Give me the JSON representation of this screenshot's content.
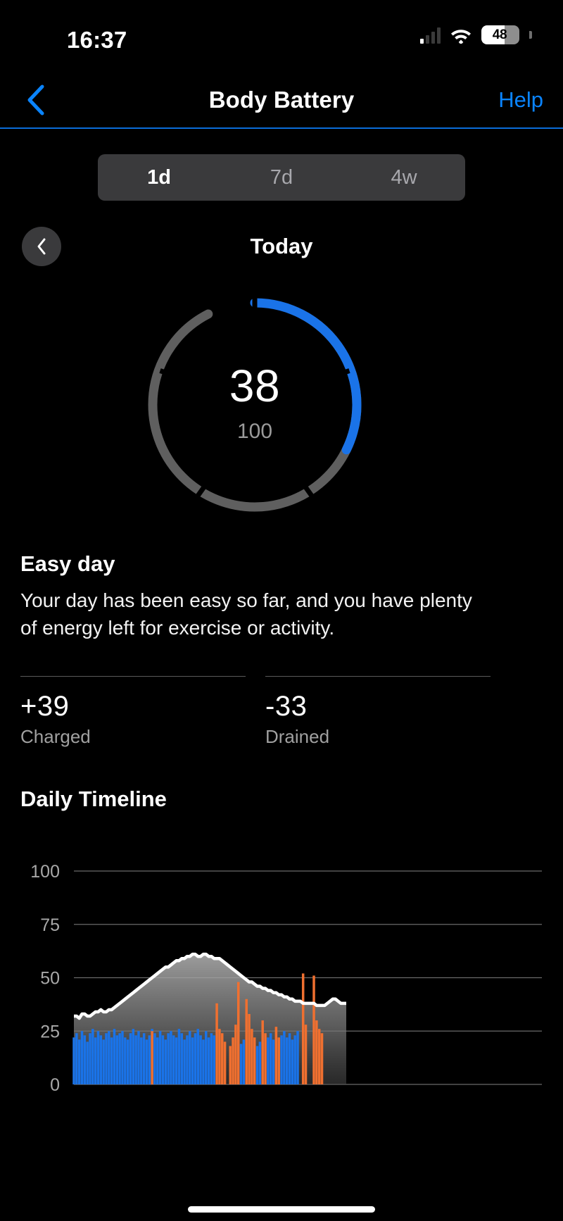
{
  "status_bar": {
    "time": "16:37",
    "signal_icon": "cellular-signal-icon",
    "wifi_icon": "wifi-icon",
    "battery_level": "48",
    "battery_icon": "battery-icon"
  },
  "nav": {
    "back_icon": "chevron-left-icon",
    "title": "Body Battery",
    "help_label": "Help"
  },
  "range_selector": {
    "options": [
      {
        "label": "1d",
        "selected": true
      },
      {
        "label": "7d",
        "selected": false
      },
      {
        "label": "4w",
        "selected": false
      }
    ]
  },
  "day_nav": {
    "prev_icon": "chevron-left-icon",
    "label": "Today"
  },
  "gauge": {
    "value": "38",
    "max": "100",
    "fill_color": "#1a73e8",
    "track_color": "#5f5f5f"
  },
  "summary": {
    "title": "Easy day",
    "description": "Your day has been easy so far, and you have plenty of energy left for exercise or activity."
  },
  "stats": [
    {
      "value": "+39",
      "label": "Charged"
    },
    {
      "value": "-33",
      "label": "Drained"
    }
  ],
  "timeline": {
    "title": "Daily Timeline"
  },
  "chart_data": {
    "type": "area",
    "title": "Daily Timeline",
    "xlabel": "",
    "ylabel": "",
    "ylim": [
      0,
      100
    ],
    "yticks": [
      0,
      25,
      50,
      75,
      100
    ],
    "ytick_labels": [
      "0",
      "25",
      "50",
      "75",
      "100"
    ],
    "grid": true,
    "legend": null,
    "line_color": "#ffffff",
    "fill_color": "#8a8a8a",
    "series": [
      {
        "name": "Body Battery",
        "type": "area",
        "values": [
          32,
          32,
          31,
          33,
          33,
          32,
          32,
          33,
          34,
          34,
          35,
          34,
          34,
          35,
          35,
          36,
          37,
          38,
          39,
          40,
          41,
          42,
          43,
          44,
          45,
          46,
          47,
          48,
          49,
          50,
          51,
          52,
          53,
          54,
          55,
          55,
          56,
          57,
          58,
          58,
          59,
          59,
          60,
          60,
          61,
          61,
          60,
          60,
          61,
          61,
          60,
          60,
          59,
          59,
          59,
          58,
          57,
          56,
          55,
          54,
          53,
          52,
          51,
          50,
          49,
          48,
          48,
          47,
          46,
          46,
          45,
          45,
          44,
          44,
          43,
          43,
          42,
          42,
          41,
          41,
          40,
          40,
          39,
          39,
          39,
          38,
          38,
          38,
          38,
          38,
          37,
          37,
          37,
          37,
          38,
          39,
          40,
          40,
          39,
          38,
          38,
          38
        ]
      },
      {
        "name": "Charge (blue bars)",
        "type": "bar",
        "color": "#1a73e8",
        "values": [
          22,
          24,
          21,
          25,
          23,
          20,
          24,
          26,
          22,
          25,
          23,
          21,
          24,
          25,
          22,
          26,
          23,
          24,
          25,
          22,
          21,
          24,
          26,
          23,
          25,
          22,
          24,
          21,
          23,
          26,
          24,
          22,
          25,
          23,
          21,
          24,
          25,
          23,
          22,
          26,
          24,
          21,
          23,
          25,
          22,
          24,
          26,
          23,
          21,
          25,
          22,
          24,
          23,
          0,
          0,
          0,
          0,
          0,
          0,
          0,
          0,
          0,
          19,
          21,
          0,
          0,
          0,
          0,
          18,
          20,
          0,
          0,
          22,
          24,
          21,
          0,
          0,
          23,
          25,
          22,
          24,
          21,
          23,
          25,
          0,
          0,
          0,
          0,
          0,
          0,
          0,
          0,
          0,
          0,
          0,
          0,
          0,
          0,
          0,
          0,
          0,
          0
        ]
      },
      {
        "name": "Drain (orange bars)",
        "type": "bar",
        "color": "#f07030",
        "values": [
          0,
          0,
          0,
          0,
          0,
          0,
          0,
          0,
          0,
          0,
          0,
          0,
          0,
          0,
          0,
          0,
          0,
          0,
          0,
          0,
          0,
          0,
          0,
          0,
          0,
          0,
          0,
          0,
          0,
          25,
          0,
          0,
          0,
          0,
          0,
          0,
          0,
          0,
          0,
          0,
          0,
          0,
          0,
          0,
          0,
          0,
          0,
          0,
          0,
          0,
          0,
          0,
          0,
          38,
          26,
          24,
          20,
          0,
          18,
          22,
          28,
          48,
          0,
          0,
          40,
          33,
          26,
          22,
          0,
          0,
          30,
          24,
          0,
          0,
          0,
          27,
          22,
          0,
          0,
          0,
          0,
          0,
          0,
          0,
          0,
          52,
          28,
          0,
          0,
          51,
          30,
          26,
          24,
          0,
          0,
          0,
          0,
          0,
          0,
          0,
          0,
          0
        ]
      }
    ]
  }
}
